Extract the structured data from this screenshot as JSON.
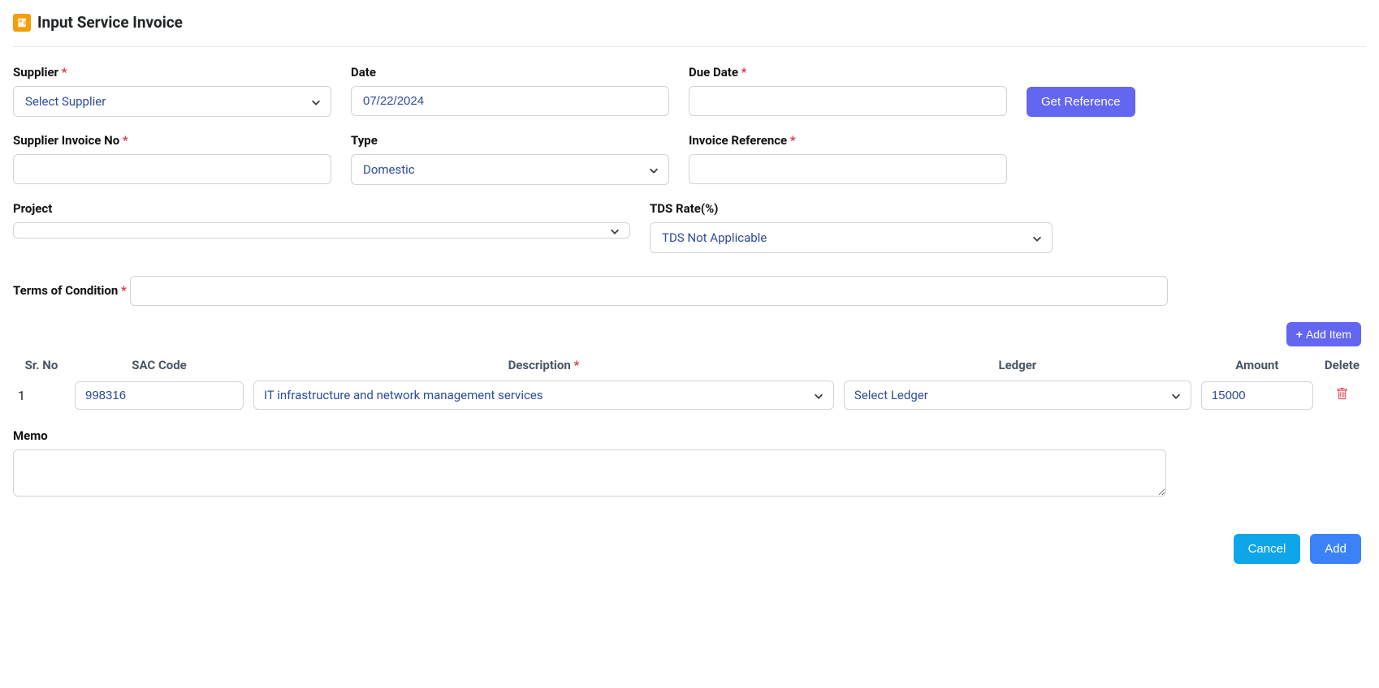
{
  "header": {
    "title": "Input Service Invoice"
  },
  "labels": {
    "supplier": "Supplier",
    "date": "Date",
    "due_date": "Due Date",
    "supplier_invoice_no": "Supplier Invoice No",
    "type": "Type",
    "invoice_reference": "Invoice Reference",
    "project": "Project",
    "tds_rate": "TDS Rate(%)",
    "terms": "Terms of Condition",
    "memo": "Memo"
  },
  "actions": {
    "get_reference": "Get Reference",
    "add_item": "Add Item",
    "cancel": "Cancel",
    "add": "Add"
  },
  "fields": {
    "supplier": "Select Supplier",
    "date": "07/22/2024",
    "due_date": "",
    "supplier_invoice_no": "",
    "type": "Domestic",
    "invoice_reference": "",
    "project": "",
    "tds_rate": "TDS Not Applicable",
    "terms": "",
    "memo": ""
  },
  "table": {
    "headers": {
      "sr": "Sr. No",
      "sac": "SAC Code",
      "desc": "Description",
      "ledger": "Ledger",
      "amount": "Amount",
      "delete": "Delete"
    },
    "rows": [
      {
        "sr": "1",
        "sac": "998316",
        "desc": "IT infrastructure and network management services",
        "ledger": "Select Ledger",
        "amount": "15000"
      }
    ]
  }
}
